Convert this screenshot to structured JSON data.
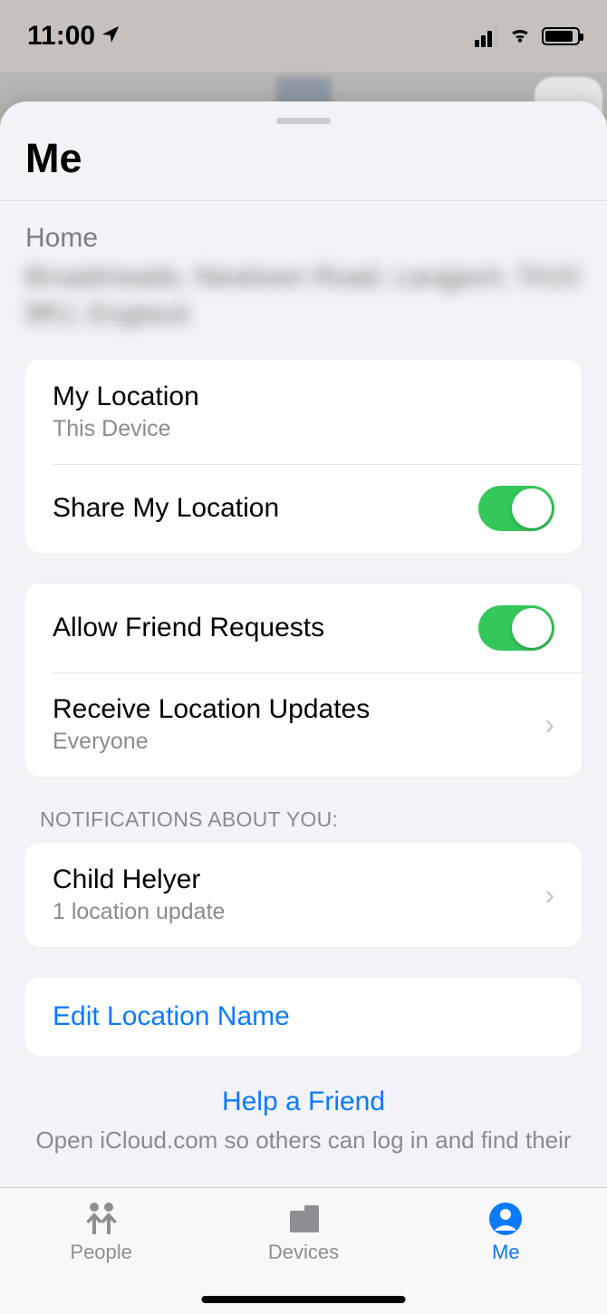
{
  "status": {
    "time": "11:00"
  },
  "sheet": {
    "title": "Me",
    "home_label": "Home",
    "home_address": "Broadmeads, Newtown Road, Langport, TA10 9RJ, England"
  },
  "group1": {
    "my_location": {
      "title": "My Location",
      "sub": "This Device"
    },
    "share": {
      "title": "Share My Location",
      "on": true
    }
  },
  "group2": {
    "allow": {
      "title": "Allow Friend Requests",
      "on": true
    },
    "receive": {
      "title": "Receive Location Updates",
      "sub": "Everyone"
    }
  },
  "notifications": {
    "header": "NOTIFICATIONS ABOUT YOU:",
    "item": {
      "title": "Child Helyer",
      "sub": "1 location update"
    }
  },
  "edit": {
    "label": "Edit Location Name"
  },
  "help": {
    "title": "Help a Friend",
    "sub": "Open iCloud.com so others can log in and find their"
  },
  "tabs": {
    "people": "People",
    "devices": "Devices",
    "me": "Me"
  }
}
